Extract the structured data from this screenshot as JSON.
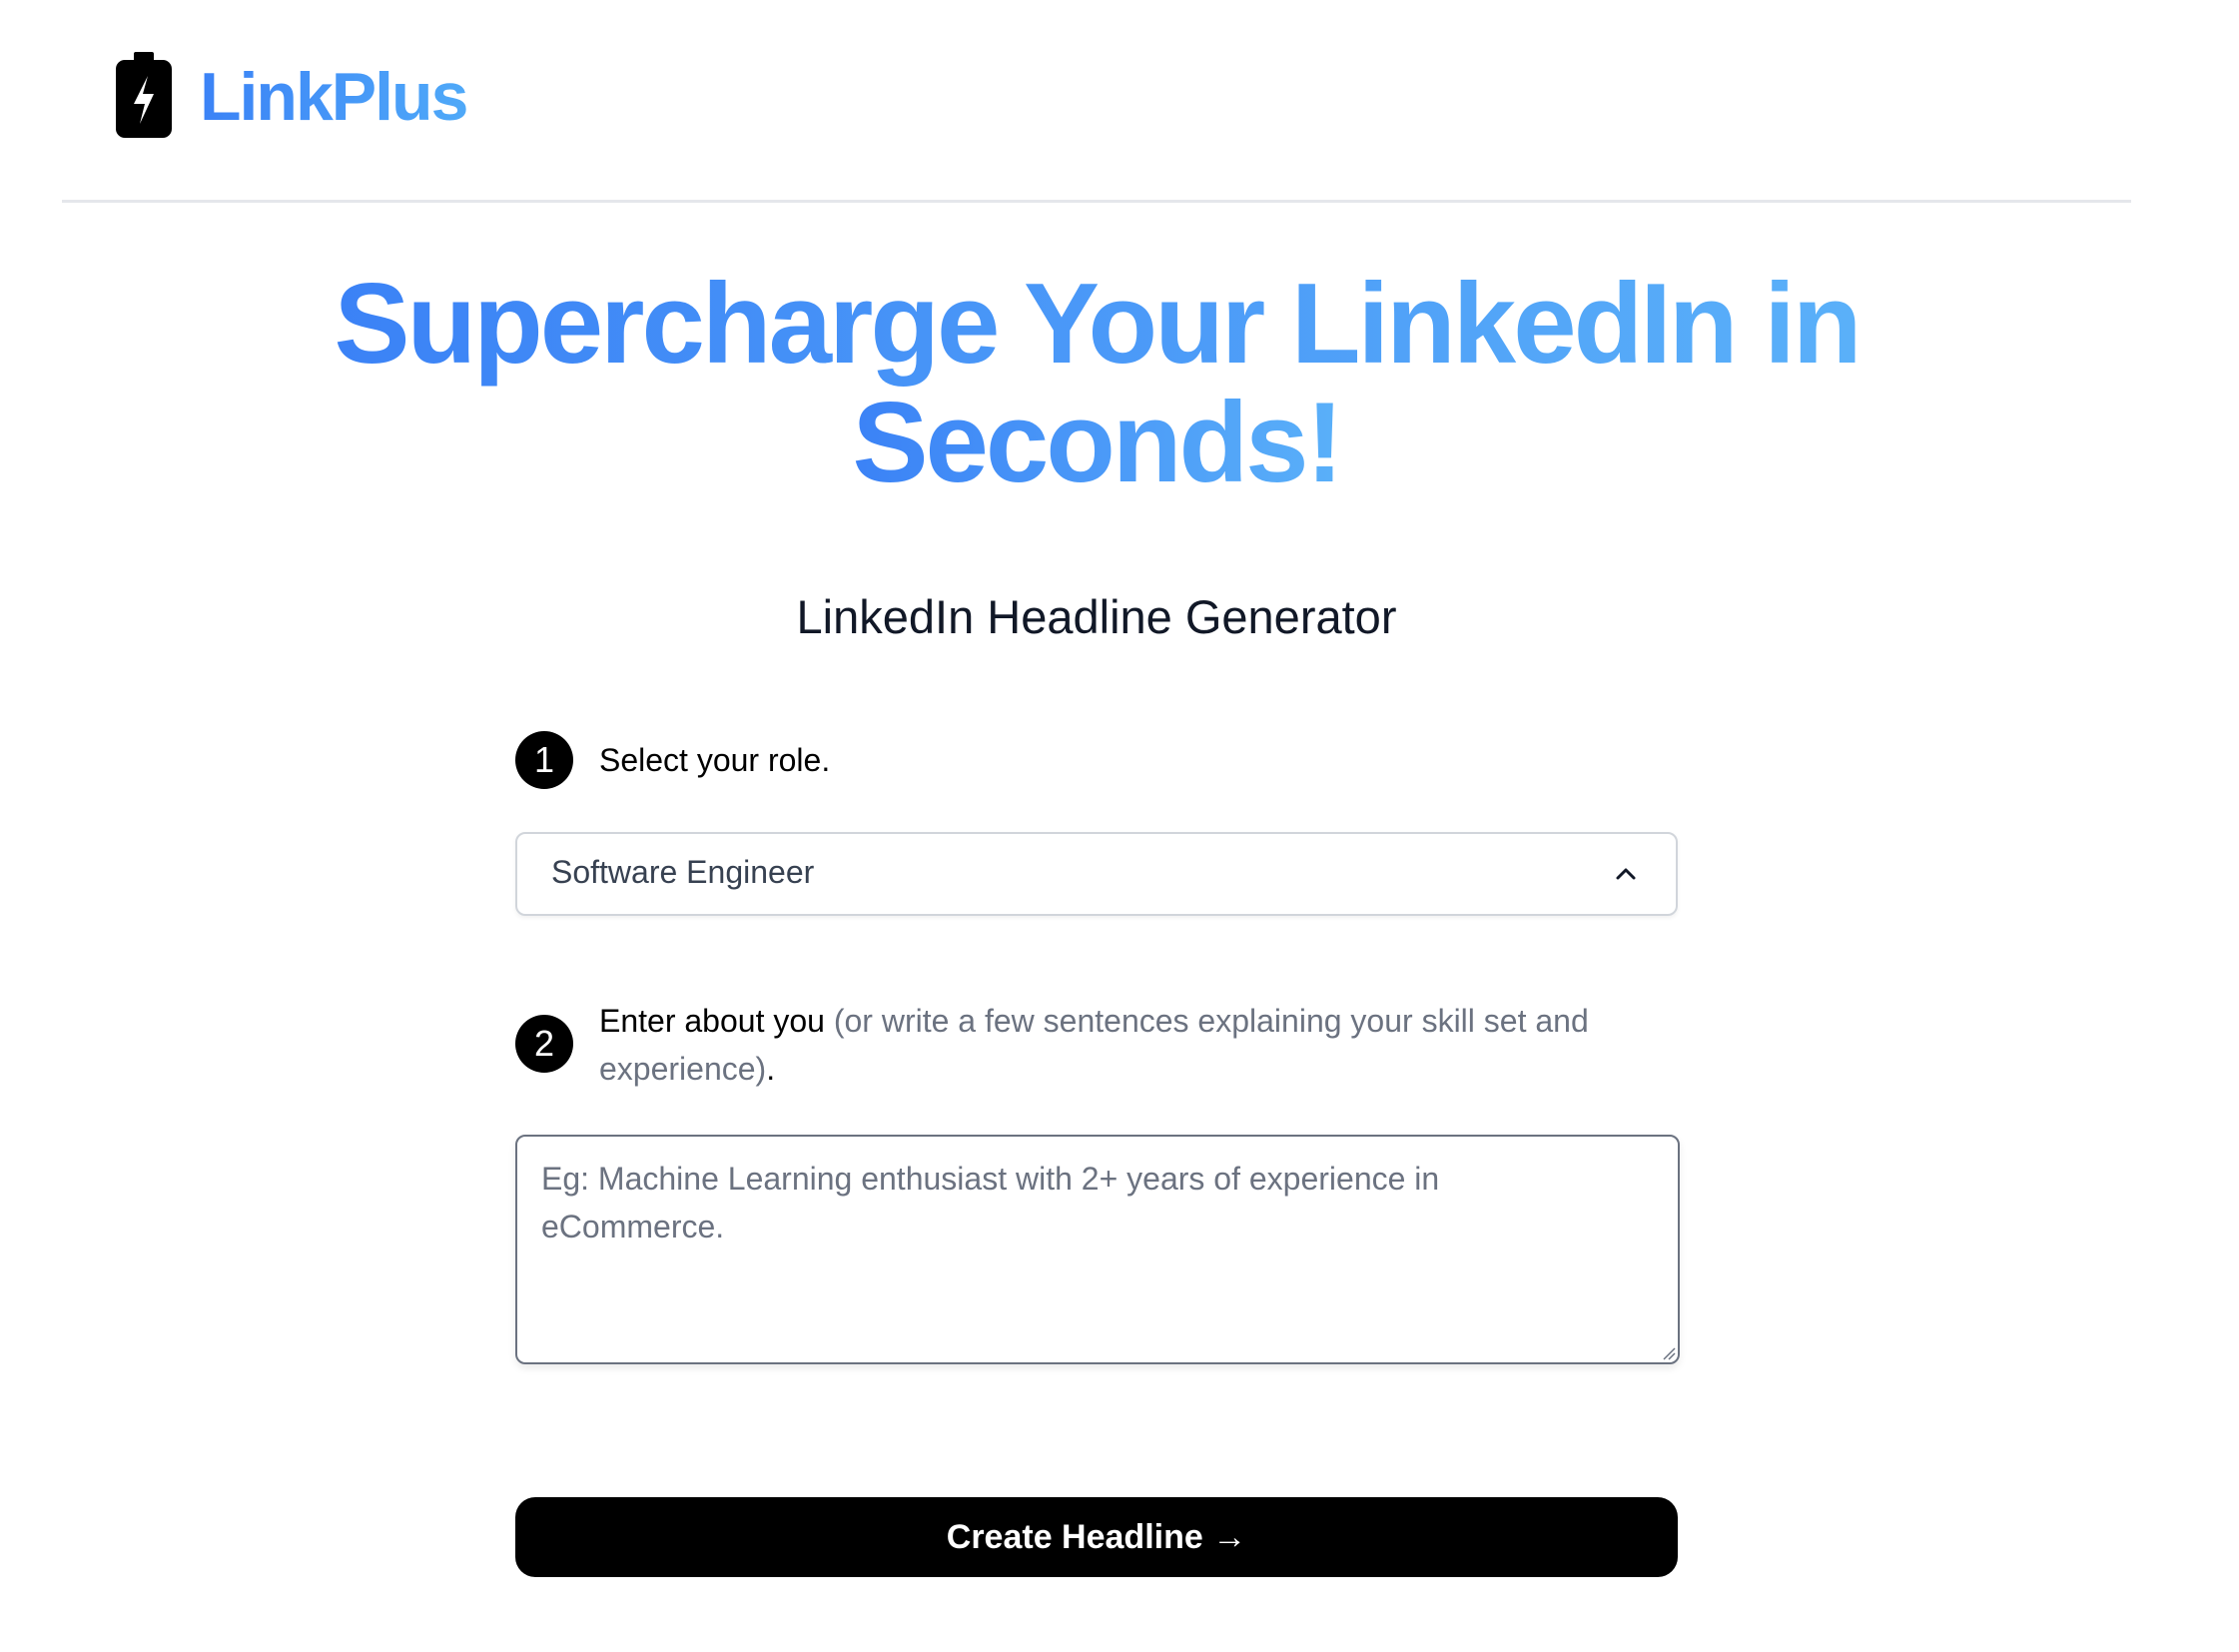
{
  "header": {
    "brand": "LinkPlus",
    "logo_icon": "battery-charging-icon",
    "brand_color": "#3b82f6"
  },
  "hero": {
    "line1": "Supercharge Your LinkedIn in",
    "line2": "Seconds!",
    "gradient": [
      "#3b82f6",
      "#5ab0f9"
    ]
  },
  "subtitle": "LinkedIn Headline Generator",
  "form": {
    "step1": {
      "number": "1",
      "label": "Select your role."
    },
    "role_select": {
      "value": "Software Engineer",
      "icon": "chevron-up-icon"
    },
    "step2": {
      "number": "2",
      "label": "Enter about you",
      "hint": "(or write a few sentences explaining your skill set and experience)",
      "suffix": "."
    },
    "about_textarea": {
      "value": "",
      "placeholder": "Eg: Machine Learning enthusiast with 2+ years of experience in eCommerce."
    },
    "submit": {
      "label": "Create Headline →"
    }
  }
}
